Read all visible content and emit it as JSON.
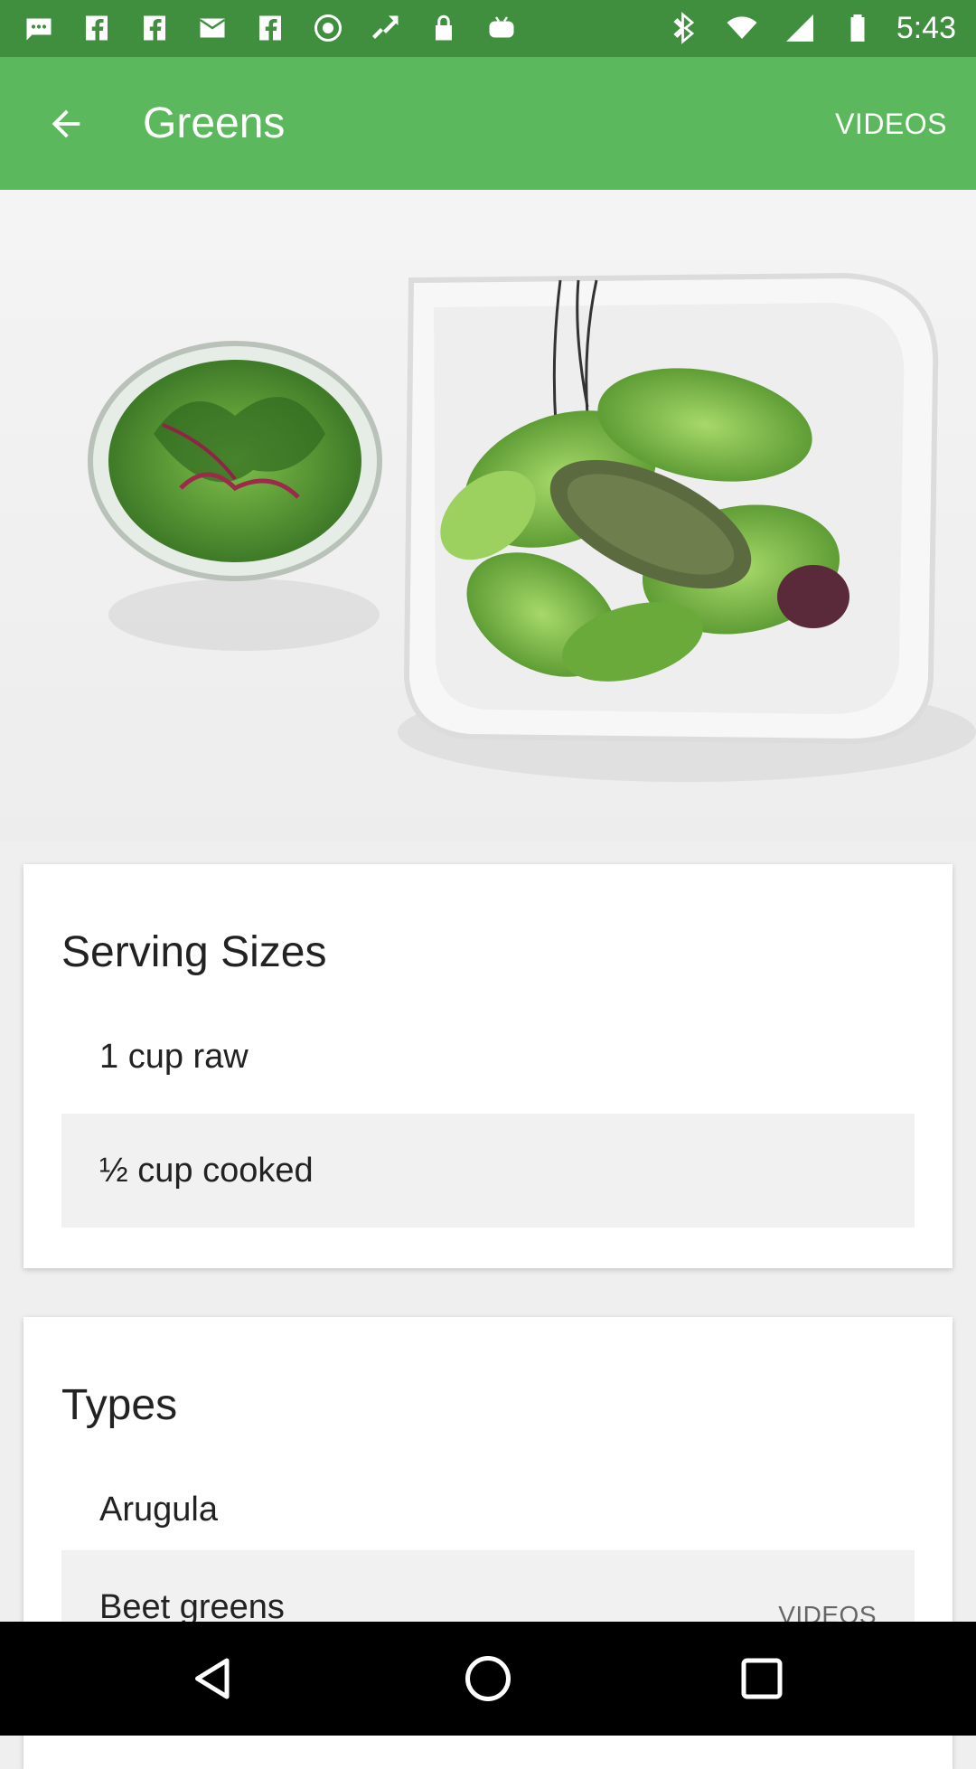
{
  "status_bar": {
    "time": "5:43",
    "icons_left": [
      "messages-icon",
      "facebook-icon",
      "facebook-icon",
      "email-icon",
      "facebook-icon",
      "sync-icon",
      "fake-gps-icon",
      "lock-icon",
      "game-controller-icon"
    ],
    "icons_right": [
      "bluetooth-icon",
      "wifi-icon",
      "signal-icon",
      "battery-icon"
    ]
  },
  "app_bar": {
    "title": "Greens",
    "action_label": "VIDEOS"
  },
  "serving_sizes": {
    "title": "Serving Sizes",
    "items": [
      {
        "label": "1 cup raw"
      },
      {
        "label": "½ cup cooked"
      }
    ]
  },
  "types": {
    "title": "Types",
    "items": [
      {
        "label": "Arugula"
      },
      {
        "label": "Beet greens",
        "trailing": "VIDEOS"
      }
    ]
  },
  "colors": {
    "status_bar": "#3f8f3f",
    "app_bar": "#5cb85c"
  }
}
